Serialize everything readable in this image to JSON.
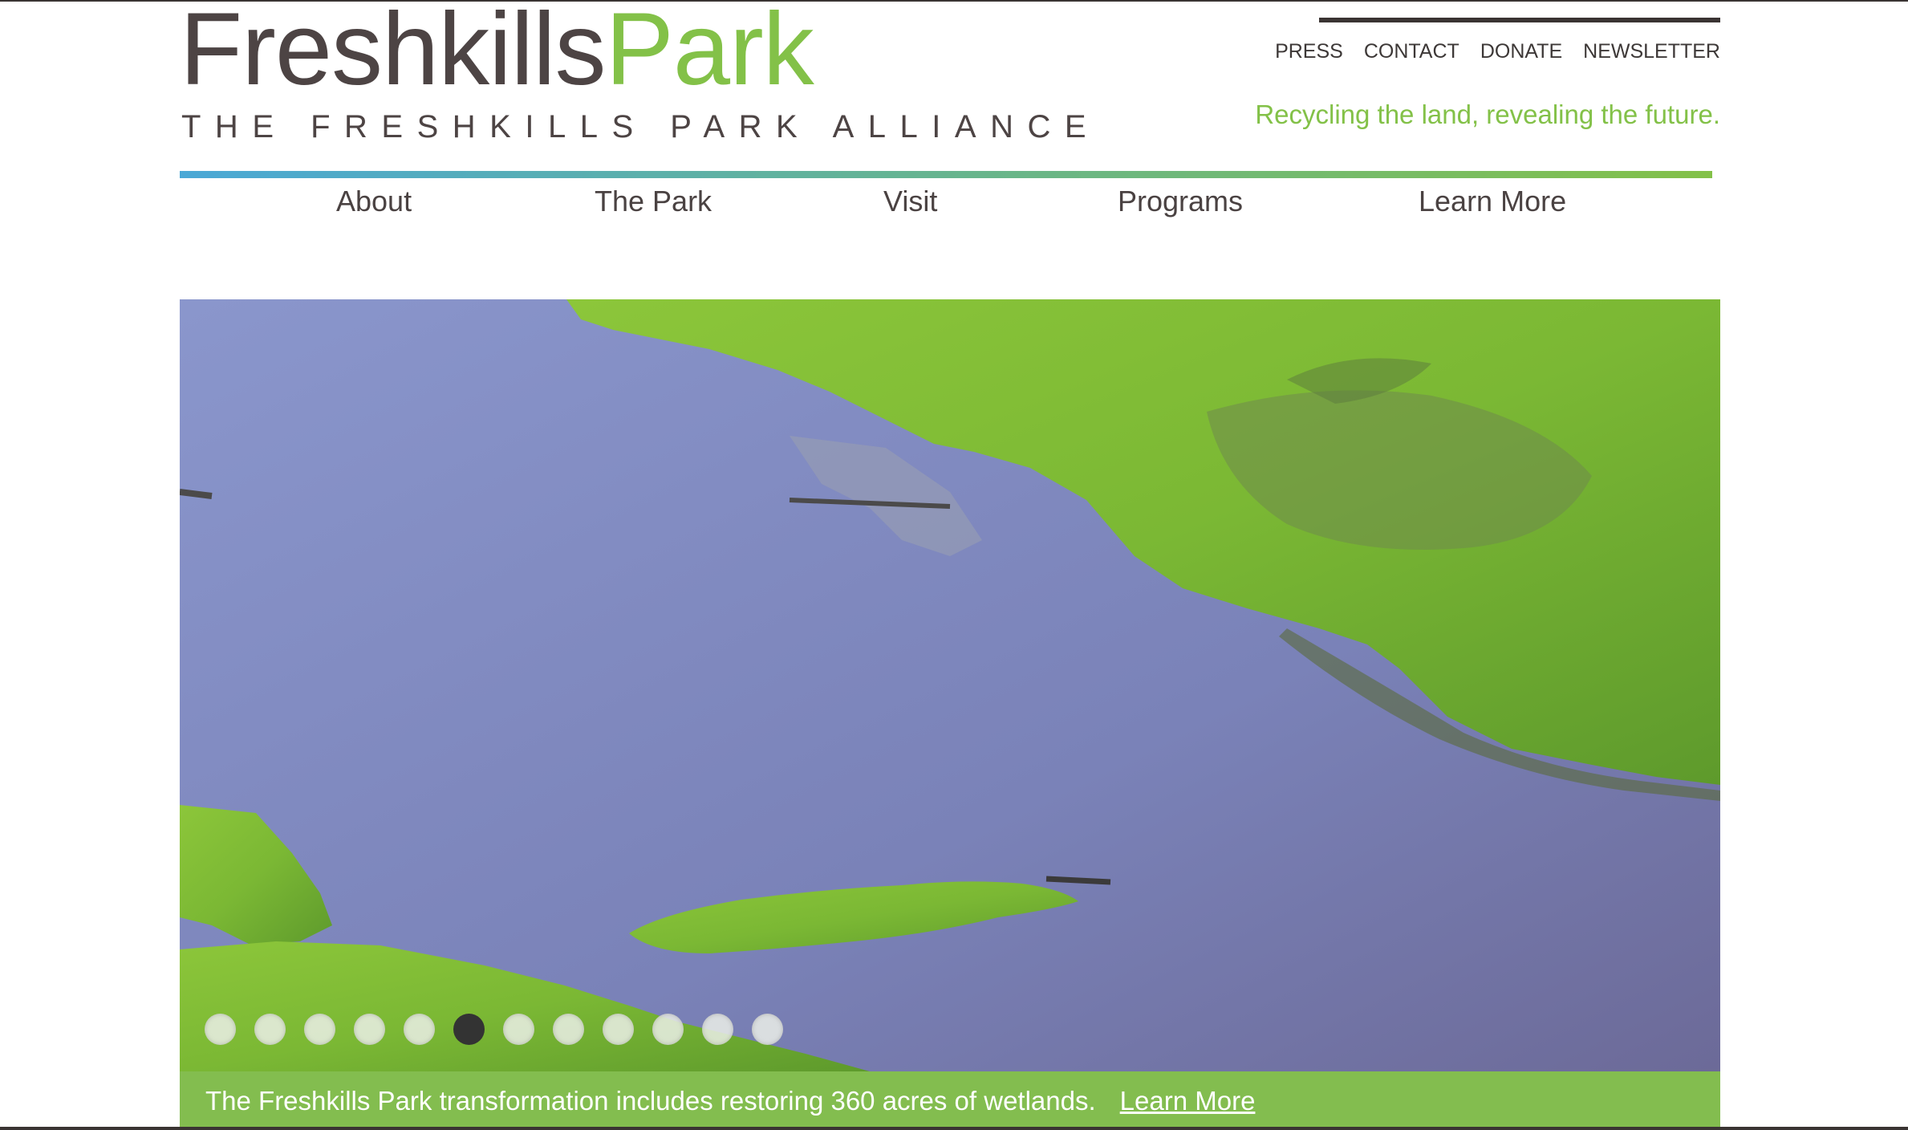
{
  "logo": {
    "word1": "Freshkills",
    "word2": "Park",
    "subtitle": "THE FRESHKILLS PARK ALLIANCE"
  },
  "utility_nav": {
    "items": [
      {
        "label": "PRESS"
      },
      {
        "label": "CONTACT"
      },
      {
        "label": "DONATE"
      },
      {
        "label": "NEWSLETTER"
      }
    ]
  },
  "tagline": "Recycling the land, revealing the future.",
  "main_nav": {
    "items": [
      {
        "label": "About"
      },
      {
        "label": "The Park"
      },
      {
        "label": "Visit"
      },
      {
        "label": "Programs"
      },
      {
        "label": "Learn More"
      }
    ]
  },
  "slideshow": {
    "slide_count": 12,
    "active_index": 5,
    "caption": "The Freshkills Park transformation includes restoring 360 acres of wetlands.",
    "caption_link": "Learn More"
  },
  "colors": {
    "brand_green": "#83c148",
    "brand_dark": "#4d4444",
    "nav_gradient_start": "#4aa8d6",
    "caption_bar": "#83bd4f"
  }
}
